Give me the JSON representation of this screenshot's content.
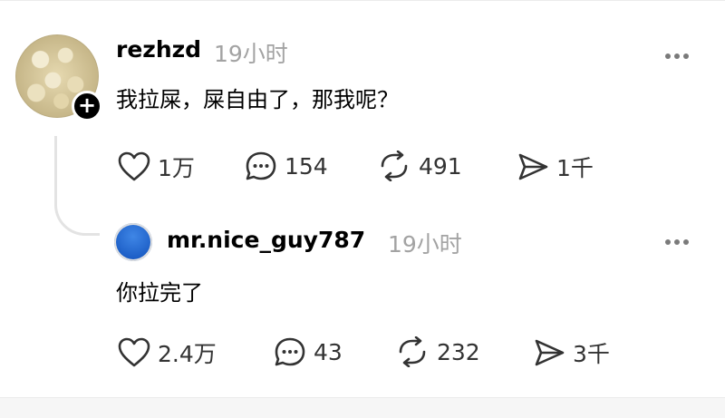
{
  "post": {
    "username": "rezhzd",
    "time": "19小时",
    "text": "我拉屎，屎自由了，那我呢？",
    "actions": {
      "likes": "1万",
      "comments": "154",
      "reposts": "491",
      "shares": "1千"
    }
  },
  "reply": {
    "username": "mr.nice_guy787",
    "time": "19小时",
    "text": "你拉完了",
    "actions": {
      "likes": "2.4万",
      "comments": "43",
      "reposts": "232",
      "shares": "3千"
    }
  },
  "icons": {
    "like": "heart-icon",
    "comment": "comment-bubble-icon",
    "repost": "repost-icon",
    "share": "send-icon",
    "more": "more-dots-icon",
    "follow": "plus-icon"
  },
  "colors": {
    "text": "#000000",
    "secondary": "#a3a3a3",
    "icon": "#333333",
    "thread_line": "#e3e3e3",
    "reply_avatar": "#1c5ec6"
  }
}
